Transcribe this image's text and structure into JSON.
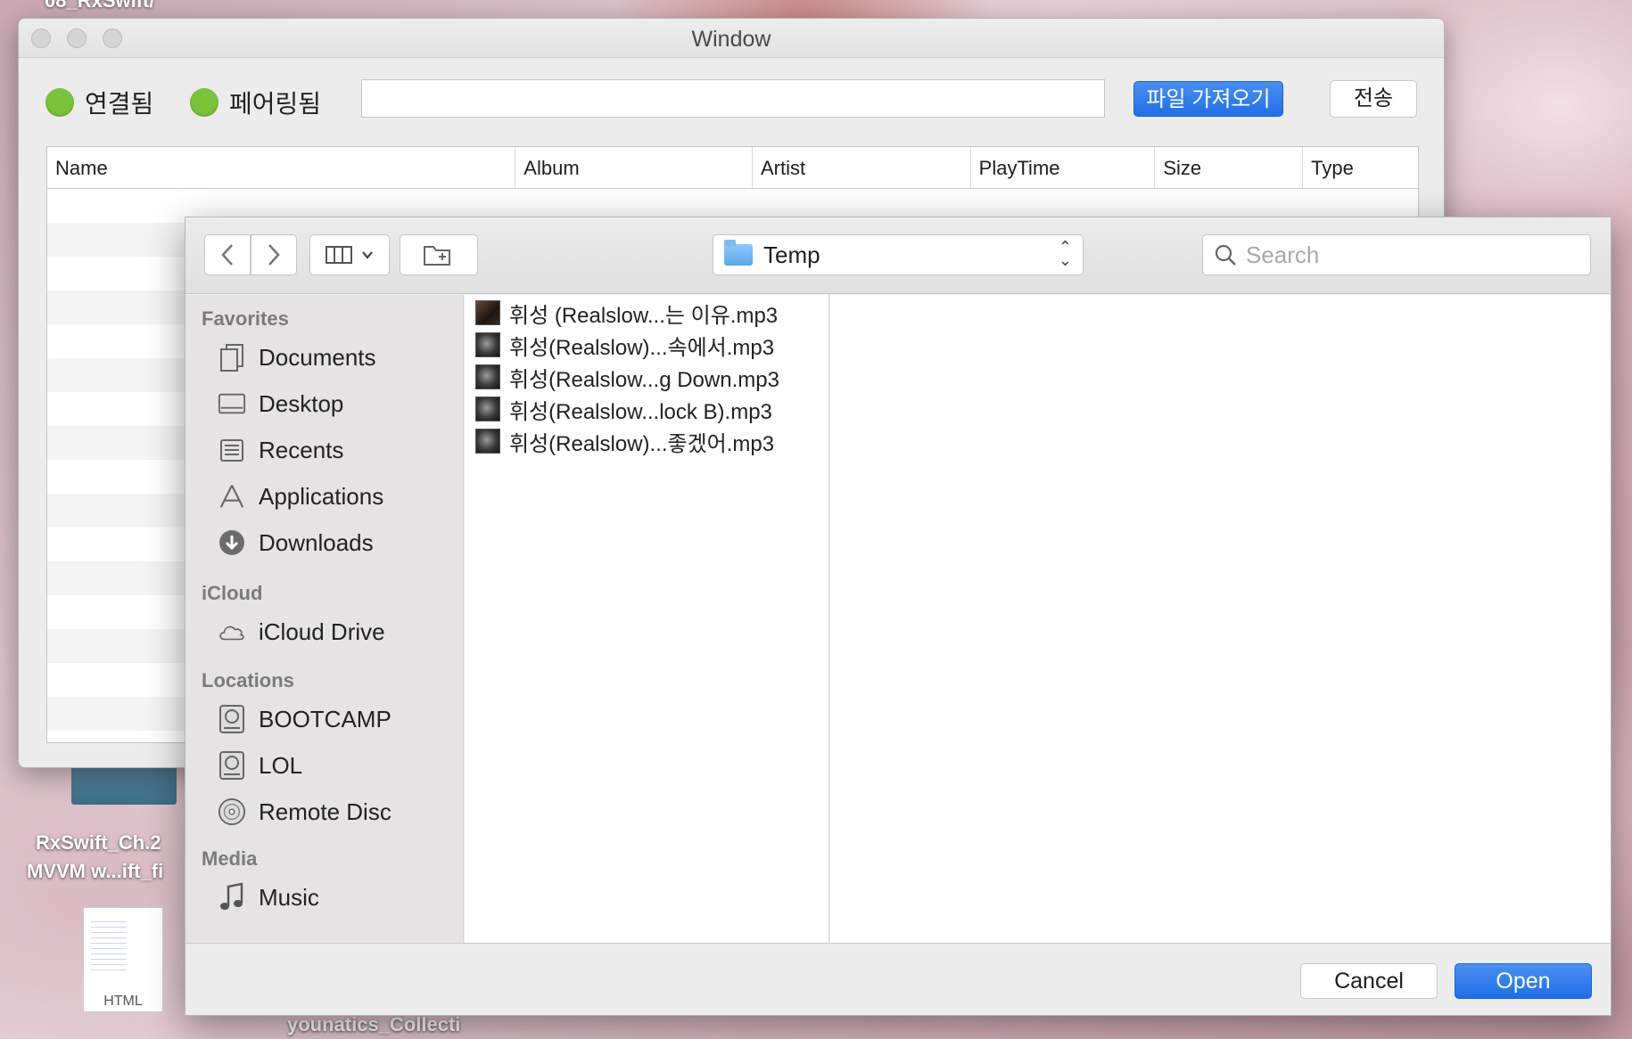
{
  "desktop": {
    "top_fragment": "08_RxSwift/",
    "folder_label_line1": "RxSwift_Ch.2",
    "folder_label_line2": "MVVM w...ift_fi",
    "file_ext": "HTML",
    "bottom_label": "younatics_Collecti"
  },
  "window": {
    "title": "Window",
    "status_connected": "연결됨",
    "status_paired": "페어링됨",
    "path_value": "",
    "import_button": "파일 가져오기",
    "send_button": "전송",
    "columns": [
      "Name",
      "Album",
      "Artist",
      "PlayTime",
      "Size",
      "Type"
    ],
    "led_color": "#7ac43a",
    "accent": "#1f6fe8"
  },
  "panel": {
    "location": "Temp",
    "search_placeholder": "Search",
    "sections": {
      "favorites": "Favorites",
      "icloud": "iCloud",
      "locations": "Locations",
      "media": "Media"
    },
    "favorites": [
      "Documents",
      "Desktop",
      "Recents",
      "Applications",
      "Downloads"
    ],
    "icloud": [
      "iCloud Drive"
    ],
    "locations": [
      "BOOTCAMP",
      "LOL",
      "Remote Disc"
    ],
    "media": [
      "Music"
    ],
    "files": [
      "휘성 (Realslow...는 이유.mp3",
      "휘성(Realslow)...속에서.mp3",
      "휘성(Realslow...g Down.mp3",
      "휘성(Realslow...lock B).mp3",
      "휘성(Realslow)...좋겠어.mp3"
    ],
    "cancel": "Cancel",
    "open": "Open"
  }
}
